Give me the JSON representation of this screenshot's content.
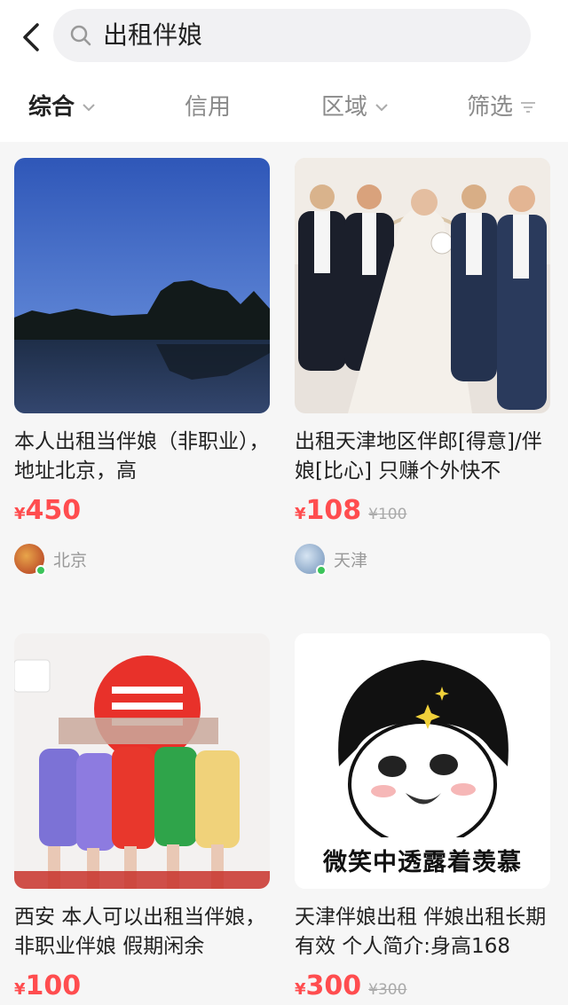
{
  "search": {
    "query": "出租伴娘"
  },
  "filters": [
    {
      "label": "综合",
      "active": true
    },
    {
      "label": "信用",
      "active": false
    },
    {
      "label": "区域",
      "active": false
    },
    {
      "label": "筛选",
      "active": false
    }
  ],
  "listings": [
    {
      "title": "本人出租当伴娘（非职业），地址北京，高",
      "currency": "¥",
      "price": "450",
      "old_price": "",
      "location": "北京",
      "image": "lake-at-dusk"
    },
    {
      "title": "出租天津地区伴郎[得意]/伴娘[比心] 只赚个外快不",
      "currency": "¥",
      "price": "108",
      "old_price": "¥100",
      "location": "天津",
      "image": "wedding-party-photo"
    },
    {
      "title": "西安 本人可以出租当伴娘，非职业伴娘 假期闲余",
      "currency": "¥",
      "price": "100",
      "old_price": "",
      "location": "",
      "image": "bridesmaids-group"
    },
    {
      "title": "天津伴娘出租 伴娘出租长期有效 个人简介:身高168",
      "currency": "¥",
      "price": "300",
      "old_price": "¥300",
      "location": "",
      "image": "meme",
      "meme_caption": "微笑中透露着羡慕"
    }
  ],
  "colors": {
    "price": "#ff4d4f",
    "online": "#3bc45a"
  }
}
